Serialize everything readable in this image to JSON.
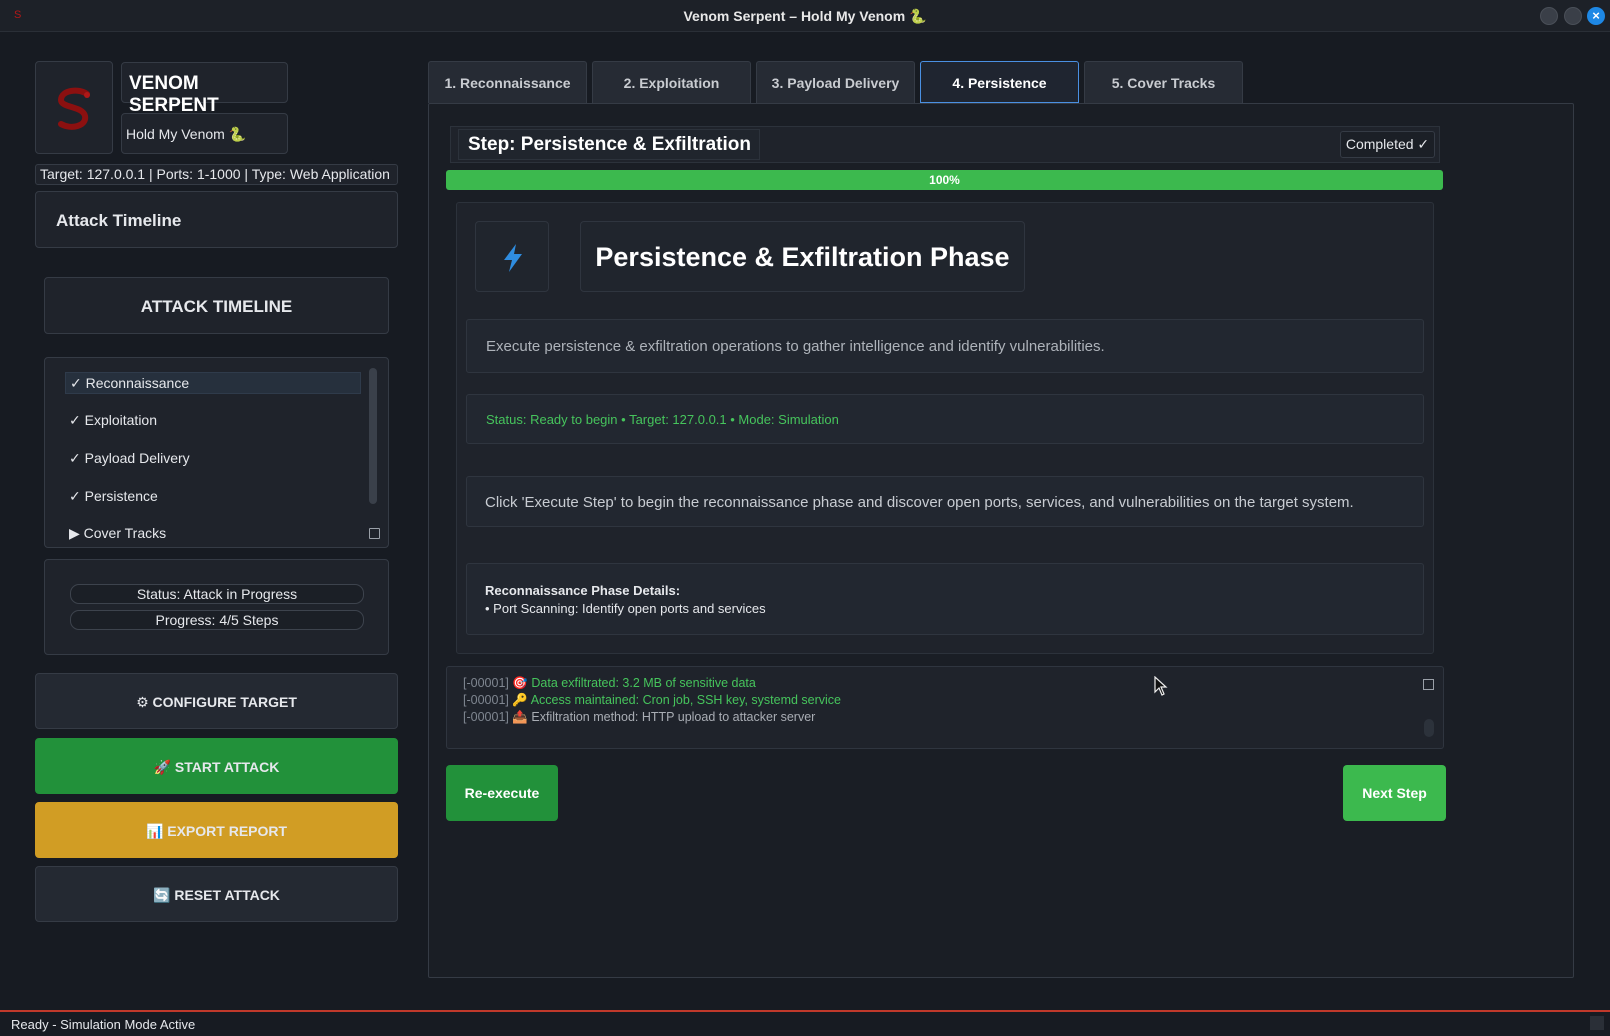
{
  "window": {
    "title": "Venom Serpent – Hold My Venom 🐍"
  },
  "brand": {
    "name": "VENOM SERPENT",
    "tagline": "Hold My Venom 🐍",
    "target_info": "Target: 127.0.0.1 | Ports: 1-1000 | Type: Web Application"
  },
  "timeline": {
    "header": "Attack Timeline",
    "title": "ATTACK TIMELINE",
    "items": [
      {
        "label": "✓ Reconnaissance"
      },
      {
        "label": "✓ Exploitation"
      },
      {
        "label": "✓ Payload Delivery"
      },
      {
        "label": "✓ Persistence"
      },
      {
        "label": "▶ Cover Tracks"
      }
    ]
  },
  "status": {
    "status_text": "Status: Attack in Progress",
    "progress_text": "Progress: 4/5 Steps"
  },
  "sidebar_buttons": {
    "configure": "⚙ CONFIGURE TARGET",
    "start": "🚀 START ATTACK",
    "export": "📊 EXPORT REPORT",
    "reset": "🔄 RESET ATTACK"
  },
  "tabs": [
    {
      "label": "1. Reconnaissance",
      "active": false
    },
    {
      "label": "2. Exploitation",
      "active": false
    },
    {
      "label": "3. Payload Delivery",
      "active": false
    },
    {
      "label": "4. Persistence",
      "active": true
    },
    {
      "label": "5. Cover Tracks",
      "active": false
    }
  ],
  "step": {
    "title": "Step: Persistence & Exfiltration",
    "status": "Completed ✓",
    "progress": 100,
    "progress_label": "100%"
  },
  "phase": {
    "icon": "lightning-icon",
    "title": "Persistence & Exfiltration Phase",
    "description": "Execute persistence & exfiltration operations to gather intelligence and identify vulnerabilities.",
    "status_line": "Status: Ready to begin • Target: 127.0.0.1 • Mode: Simulation",
    "hint": "Click 'Execute Step' to begin the reconnaissance phase and discover open ports, services, and vulnerabilities on the target system.",
    "details_heading": "Reconnaissance Phase Details:",
    "details_item": "• Port Scanning: Identify open ports and services"
  },
  "log": {
    "lines": [
      {
        "id": "[-00001]",
        "text": "🎯 Data exfiltrated: 3.2 MB of sensitive data",
        "color": "green"
      },
      {
        "id": "[-00001]",
        "text": "🔑 Access maintained: Cron job, SSH key, systemd service",
        "color": "green"
      },
      {
        "id": "[-00001]",
        "text": "📤 Exfiltration method: HTTP upload to attacker server",
        "color": "gray"
      }
    ]
  },
  "actions": {
    "reexecute": "Re-execute",
    "next": "Next Step"
  },
  "statusbar": {
    "text": "Ready - Simulation Mode Active"
  },
  "colors": {
    "accent_green": "#3cb94e",
    "button_green": "#22913a",
    "export_yellow": "#d19d24",
    "tab_active_border": "#4a90e2",
    "statusbar_line": "#c0392b"
  }
}
